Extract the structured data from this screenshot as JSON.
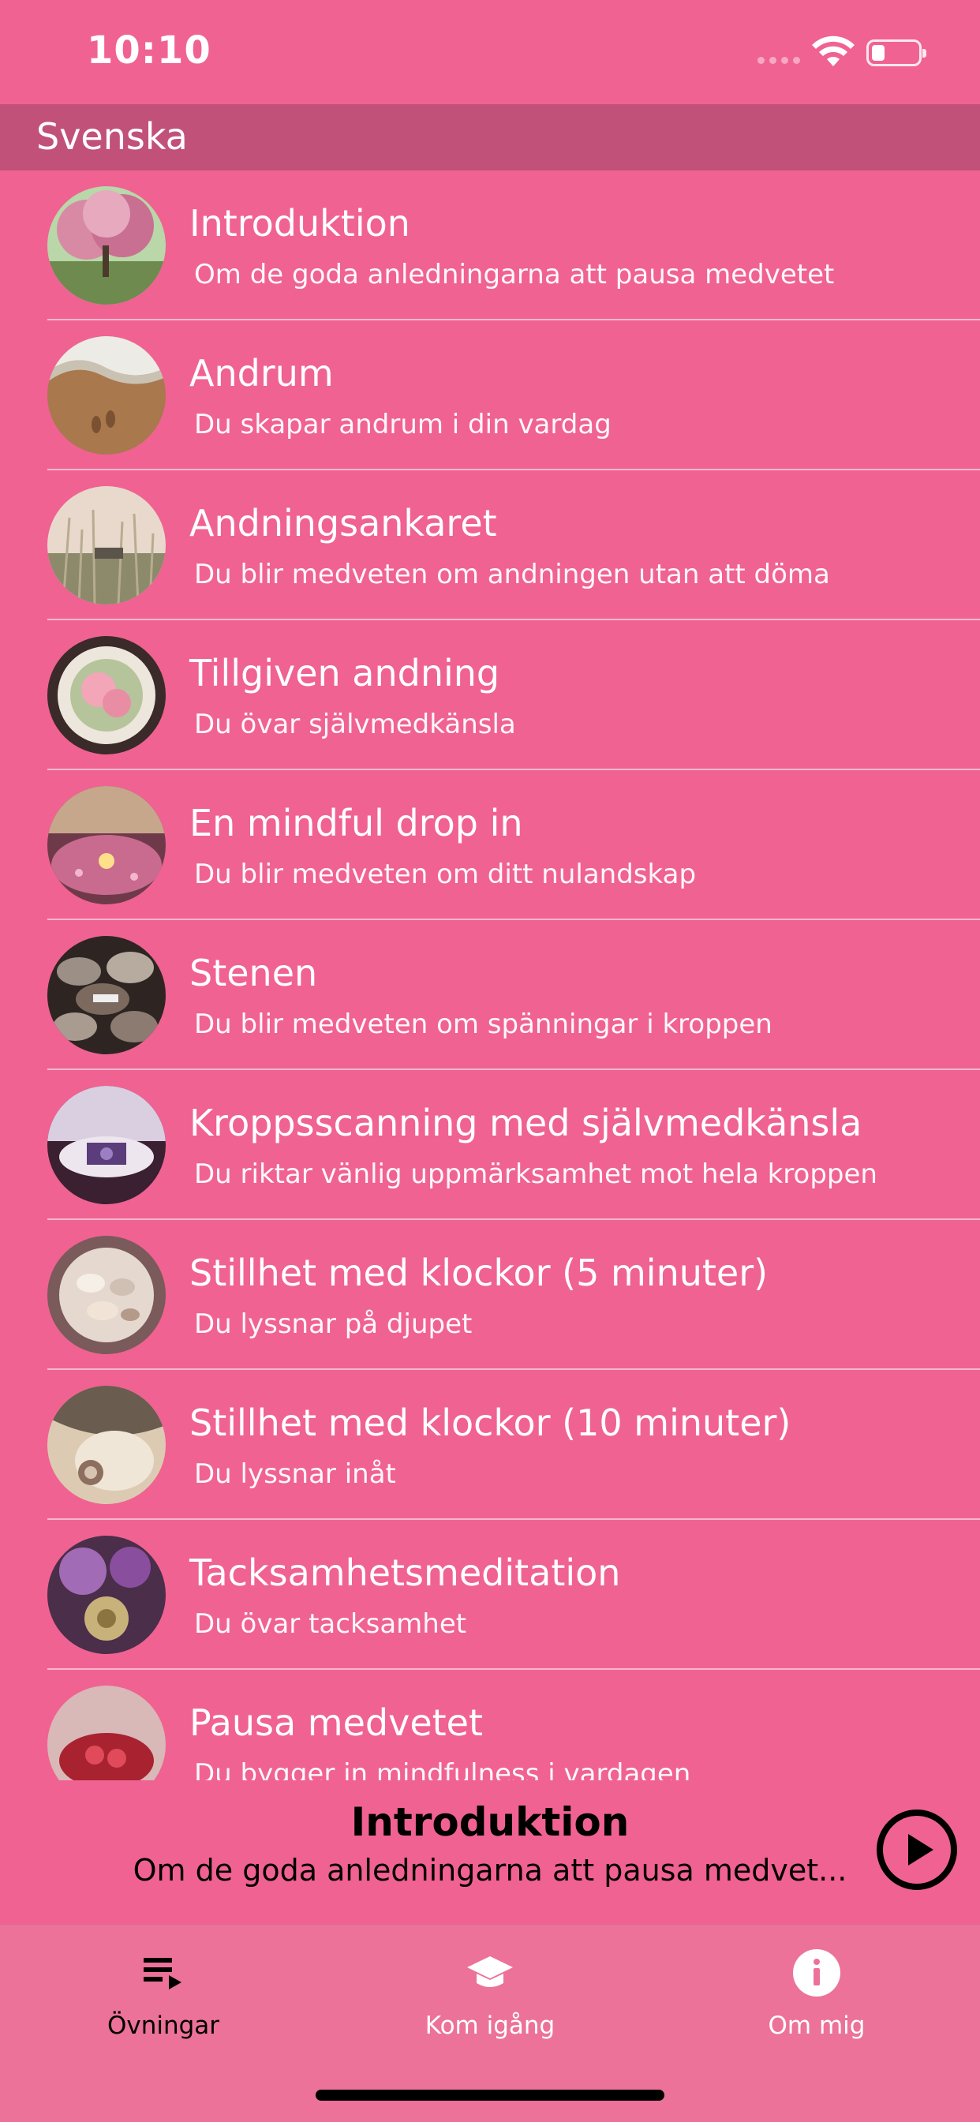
{
  "status_bar": {
    "time": "10:10",
    "battery_level": 0.25
  },
  "section_header": {
    "title": "Svenska"
  },
  "exercises": [
    {
      "title": "Introduktion",
      "subtitle": "Om de goda anledningarna att pausa medvetet",
      "thumb": "blossom-tree"
    },
    {
      "title": "Andrum",
      "subtitle": "Du skapar andrum i din vardag",
      "thumb": "beach-footprints"
    },
    {
      "title": "Andningsankaret",
      "subtitle": "Du blir medveten om andningen utan att döma",
      "thumb": "grass-field"
    },
    {
      "title": "Tillgiven andning",
      "subtitle": "Du övar självmedkänsla",
      "thumb": "pink-rose-bowl"
    },
    {
      "title": "En mindful drop in",
      "subtitle": "Du blir medveten om ditt nulandskap",
      "thumb": "candle-petals"
    },
    {
      "title": "Stenen",
      "subtitle": "Du blir medveten om spänningar i kroppen",
      "thumb": "stones"
    },
    {
      "title": "Kroppsscanning med självmedkänsla",
      "subtitle": "Du riktar vänlig uppmärksamhet mot hela kroppen",
      "thumb": "meditation-cushion"
    },
    {
      "title": "Stillhet med klockor (5 minuter)",
      "subtitle": "Du lyssnar på djupet",
      "thumb": "shells"
    },
    {
      "title": "Stillhet med klockor (10 minuter)",
      "subtitle": "Du lyssnar inåt",
      "thumb": "shell-closeup"
    },
    {
      "title": "Tacksamhetsmeditation",
      "subtitle": "Du övar tacksamhet",
      "thumb": "lilac-bell"
    },
    {
      "title": "Pausa medvetet",
      "subtitle": "Du bygger in mindfulness i vardagen",
      "thumb": "red-bowl"
    }
  ],
  "now_playing": {
    "title": "Introduktion",
    "subtitle": "Om de goda anledningarna att pausa medvet...",
    "play_icon": "play-circle-icon"
  },
  "tabs": [
    {
      "label": "Övningar",
      "icon": "playlist-icon",
      "active": true
    },
    {
      "label": "Kom igång",
      "icon": "graduation-cap-icon",
      "active": false
    },
    {
      "label": "Om mig",
      "icon": "info-icon",
      "active": false
    }
  ],
  "colors": {
    "background": "#F06292",
    "section_header": "#C2517A",
    "tab_bar": "#EC7299",
    "active_tab": "#000000",
    "inactive_tab": "#FFFFFF"
  }
}
